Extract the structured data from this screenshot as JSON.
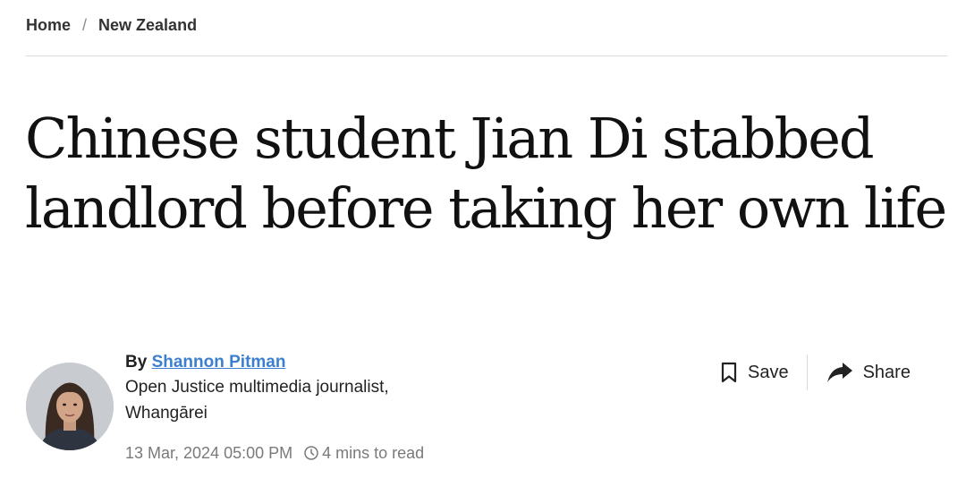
{
  "breadcrumb": {
    "home": "Home",
    "separator": "/",
    "section": "New Zealand"
  },
  "article": {
    "headline": "Chinese student Jian Di stabbed landlord before taking her own life",
    "byline_prefix": "By",
    "author_name": "Shannon Pitman",
    "author_role_line1": "Open Justice multimedia journalist,",
    "author_role_line2": "Whangārei",
    "date": "13 Mar, 2024 05:00 PM",
    "read_time": "4 mins to read"
  },
  "actions": {
    "save_label": "Save",
    "share_label": "Share",
    "save_icon": "bookmark-icon",
    "share_icon": "share-arrow-icon"
  },
  "colors": {
    "link": "#3d7fcf",
    "meta_text": "#7a7a7a",
    "rule": "#d9d9d9"
  }
}
